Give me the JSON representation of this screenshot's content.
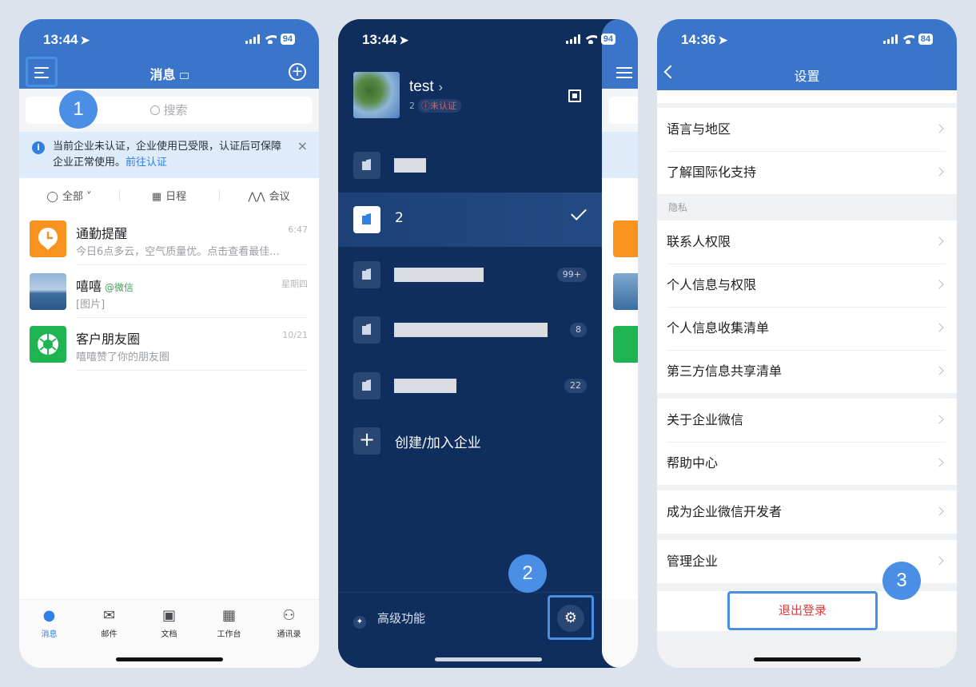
{
  "phone1": {
    "status": {
      "time": "13:44",
      "battery": "94"
    },
    "header": {
      "title": "消息"
    },
    "search": {
      "placeholder": "搜索"
    },
    "notice": {
      "text": "当前企业未认证，企业使用已受限，认证后可保障企业正常使用。",
      "link": "前往认证"
    },
    "filters": [
      "全部",
      "日程",
      "会议"
    ],
    "messages": [
      {
        "name": "通勤提醒",
        "tag": "",
        "preview": "今日6点多云，空气质量优。点击查看最佳...",
        "time": "6:47",
        "avatar_color": "#f7931e"
      },
      {
        "name": "嘻嘻",
        "tag": "@微信",
        "preview": "[图片]",
        "time": "星期四",
        "avatar_color": "#5b8fc6"
      },
      {
        "name": "客户朋友圈",
        "tag": "",
        "preview": "嘻嘻赞了你的朋友圈",
        "time": "10/21",
        "avatar_color": "#1fb452"
      }
    ],
    "tabs": [
      "消息",
      "邮件",
      "文档",
      "工作台",
      "通讯录"
    ],
    "step": "1"
  },
  "phone2": {
    "status": {
      "time": "13:44",
      "battery": "94"
    },
    "profile": {
      "name": "test",
      "id": "2",
      "badge": "未认证"
    },
    "corps": [
      {
        "name": "",
        "count": "",
        "selected": false,
        "bar_width": 40
      },
      {
        "name": "2",
        "count": "",
        "selected": true,
        "bar_width": 0
      },
      {
        "name": "",
        "count": "99+",
        "selected": false,
        "bar_width": 112
      },
      {
        "name": "",
        "count": "8",
        "selected": false,
        "bar_width": 192
      },
      {
        "name": "",
        "count": "22",
        "selected": false,
        "bar_width": 78
      }
    ],
    "add_corp": "创建/加入企业",
    "advanced": "高级功能",
    "step": "2"
  },
  "phone3": {
    "status": {
      "time": "14:36",
      "battery": "84"
    },
    "title": "设置",
    "group1": [
      "语言与地区",
      "了解国际化支持"
    ],
    "privacy_label": "隐私",
    "group2": [
      "联系人权限",
      "个人信息与权限",
      "个人信息收集清单",
      "第三方信息共享清单"
    ],
    "group3": [
      "关于企业微信",
      "帮助中心"
    ],
    "group4": [
      "成为企业微信开发者"
    ],
    "group5": [
      "管理企业"
    ],
    "logout": "退出登录",
    "step": "3"
  },
  "colors": {
    "brand_blue": "#3b75c9",
    "drawer_navy": "#0f2e5d",
    "highlight": "#4a90e2",
    "danger": "#e03b3b"
  }
}
